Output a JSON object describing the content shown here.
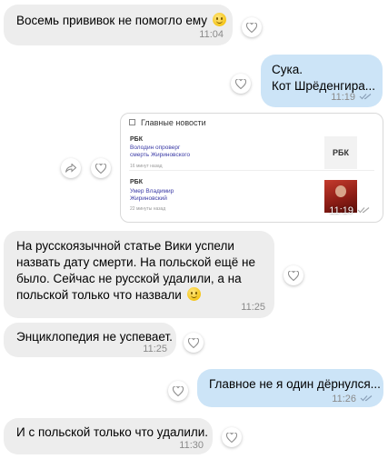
{
  "messages": [
    {
      "text": "Восемь прививок не помогло ему",
      "time": "11:04"
    },
    {
      "line1": "Сука.",
      "line2": "Кот Шрёденгира...",
      "time": "11:19"
    },
    {
      "card_title": "Главные новости",
      "news": [
        {
          "source": "РБК",
          "headline1": "Володин опроверг",
          "headline2": "смерть Жириновского",
          "meta": "16 минут назад",
          "thumb": "РБК"
        },
        {
          "source": "РБК",
          "headline1": "Умер Владимир",
          "headline2": "Жириновский",
          "meta": "22 минуты назад"
        }
      ],
      "time": "11:19"
    },
    {
      "lines": [
        "На русскоязычной статье Вики успели",
        "назвать дату смерти. На польской ещё не",
        "было. Сейчас не русской удалили, а на",
        "польской только что назвали"
      ],
      "time": "11:25"
    },
    {
      "text": "Энциклопедия не успевает.",
      "time": "11:25"
    },
    {
      "text": "Главное не я один дёрнулся...",
      "time": "11:26"
    },
    {
      "text": "И с польской только что удалили.",
      "time": "11:30"
    }
  ]
}
